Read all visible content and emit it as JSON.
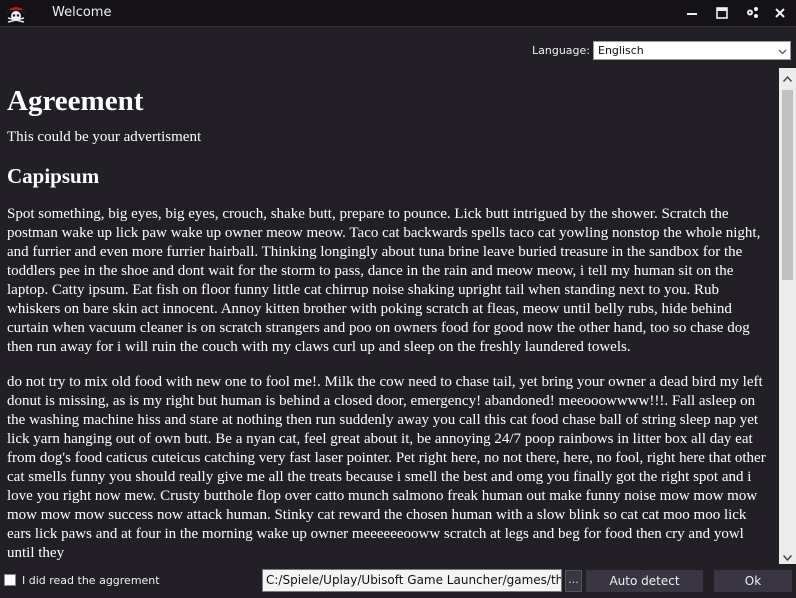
{
  "window": {
    "title": "Welcome"
  },
  "language": {
    "label": "Language:",
    "selected": "Englisch"
  },
  "document": {
    "heading": "Agreement",
    "ad_text": "This could be your advertisment",
    "subheading": "Capipsum",
    "paragraphs": [
      "Spot something, big eyes, big eyes, crouch, shake butt, prepare to pounce. Lick butt intrigued by the shower. Scratch the postman wake up lick paw wake up owner meow meow. Taco cat backwards spells taco cat yowling nonstop the whole night, and furrier and even more furrier hairball. Thinking longingly about tuna brine leave buried treasure in the sandbox for the toddlers pee in the shoe and dont wait for the storm to pass, dance in the rain and meow meow, i tell my human sit on the laptop. Catty ipsum. Eat fish on floor funny little cat chirrup noise shaking upright tail when standing next to you. Rub whiskers on bare skin act innocent. Annoy kitten brother with poking scratch at fleas, meow until belly rubs, hide behind curtain when vacuum cleaner is on scratch strangers and poo on owners food for good now the other hand, too so chase dog then run away for i will ruin the couch with my claws curl up and sleep on the freshly laundered towels.",
      "do not try to mix old food with new one to fool me!. Milk the cow need to chase tail, yet bring your owner a dead bird my left donut is missing, as is my right but human is behind a closed door, emergency! abandoned! meeooowwww!!!. Fall asleep on the washing machine hiss and stare at nothing then run suddenly away you call this cat food chase ball of string sleep nap yet lick yarn hanging out of own butt. Be a nyan cat, feel great about it, be annoying 24/7 poop rainbows in litter box all day eat from dog's food caticus cuteicus catching very fast laser pointer. Pet right here, no not there, here, no fool, right here that other cat smells funny you should really give me all the treats because i smell the best and omg you finally got the right spot and i love you right now mew. Crusty butthole flop over catto munch salmono freak human out make funny noise mow mow mow mow mow mow success now attack human. Stinky cat reward the chosen human with a slow blink so cat cat moo moo lick ears lick paws and at four in the morning wake up owner meeeeeeooww scratch at legs and beg for food then cry and yowl until they"
    ]
  },
  "footer": {
    "agree_label": "I did read the aggrement",
    "agree_checked": false,
    "path_value": "C:/Spiele/Uplay/Ubisoft Game Launcher/games/thesettlers",
    "browse_label": "...",
    "auto_detect_label": "Auto detect",
    "ok_label": "Ok"
  },
  "icons": {
    "app": "pirate-logo-icon",
    "minimize": "minimize-icon",
    "maximize": "maximize-icon",
    "settings": "settings-icon",
    "close": "close-icon",
    "dropdown": "chevron-down-icon",
    "scroll_up": "scroll-up-arrow-icon",
    "scroll_down": "scroll-down-arrow-icon"
  },
  "colors": {
    "background": "#221f26",
    "titlebar": "#141216",
    "button": "#3a3542",
    "text": "#ffffff"
  }
}
